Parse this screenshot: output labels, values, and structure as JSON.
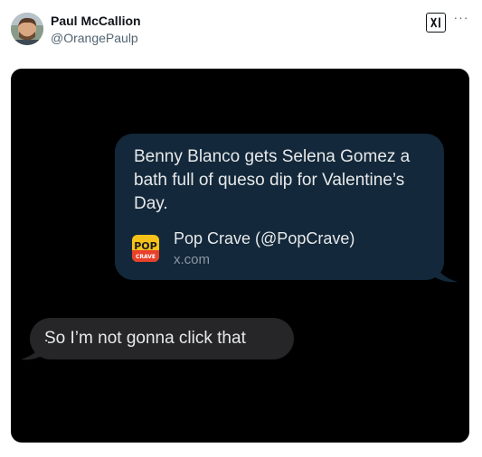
{
  "post": {
    "author_name": "Paul McCallion",
    "author_handle": "@OrangePaulp",
    "more_label": "···"
  },
  "media": {
    "sent_message": {
      "text": "Benny Blanco gets Selena Gomez a bath full of queso dip for Valentine’s Day.",
      "link_title": "Pop Crave (@PopCrave)",
      "link_domain": "x.com",
      "link_icon_text_top": "POP",
      "link_icon_text_bottom": "CRAVE"
    },
    "received_message": {
      "text": "So I’m not gonna click that"
    },
    "colors": {
      "sent_bubble": "#13283a",
      "received_bubble": "#262628",
      "background": "#000000"
    }
  },
  "icons": {
    "header_logo": "xai-logo-icon",
    "link_icon": "pop-crave-logo-icon",
    "menu": "more-options-icon"
  }
}
